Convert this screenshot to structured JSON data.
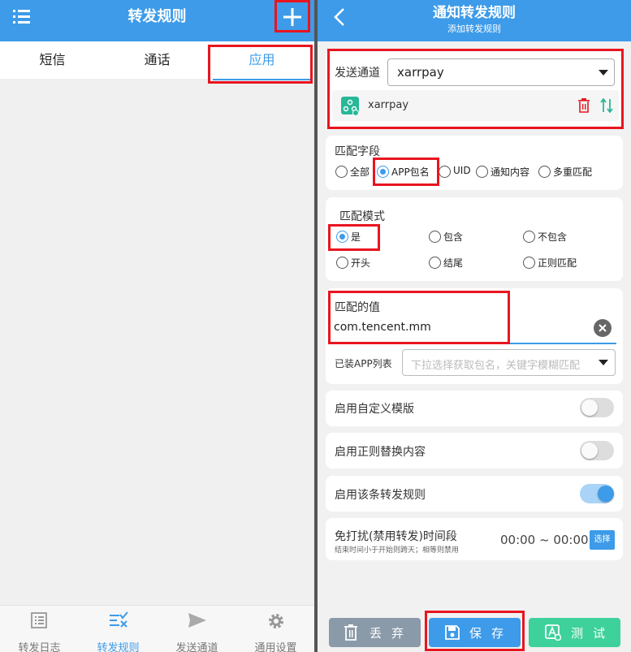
{
  "left": {
    "title": "转发规则",
    "tabs": [
      {
        "label": "短信"
      },
      {
        "label": "通话"
      },
      {
        "label": "应用"
      }
    ],
    "nav": [
      {
        "label": "转发日志"
      },
      {
        "label": "转发规则"
      },
      {
        "label": "发送通道"
      },
      {
        "label": "通用设置"
      }
    ]
  },
  "right": {
    "title": "通知转发规则",
    "subtitle": "添加转发规则",
    "channel": {
      "label": "发送通道",
      "selected": "xarrpay",
      "item": "xarrpay"
    },
    "match_field": {
      "label": "匹配字段",
      "options": [
        "全部",
        "APP包名",
        "UID",
        "通知内容",
        "多重匹配"
      ],
      "selected": "APP包名"
    },
    "match_mode": {
      "label": "匹配模式",
      "options": [
        "是",
        "包含",
        "不包含",
        "开头",
        "结尾",
        "正则匹配"
      ],
      "selected": "是"
    },
    "match_value": {
      "label": "匹配的值",
      "value": "com.tencent.mm",
      "installed_label": "已装APP列表",
      "installed_placeholder": "下拉选择获取包名，关键字模糊匹配"
    },
    "toggles": [
      {
        "label": "启用自定义模版",
        "on": false
      },
      {
        "label": "启用正则替换内容",
        "on": false
      },
      {
        "label": "启用该条转发规则",
        "on": true
      }
    ],
    "dnd": {
      "label": "免打扰(禁用转发)时间段",
      "hint": "结束时间小于开始则跨天；相等则禁用",
      "time": "00:00 ~ 00:00",
      "button": "选择"
    },
    "buttons": {
      "discard": "丢弃",
      "save": "保存",
      "test": "测试"
    }
  },
  "colors": {
    "primary": "#3d9be9",
    "highlight": "#e8151f",
    "discard": "#8a9aa8",
    "test": "#3ed19b",
    "delete": "#e8151f"
  }
}
